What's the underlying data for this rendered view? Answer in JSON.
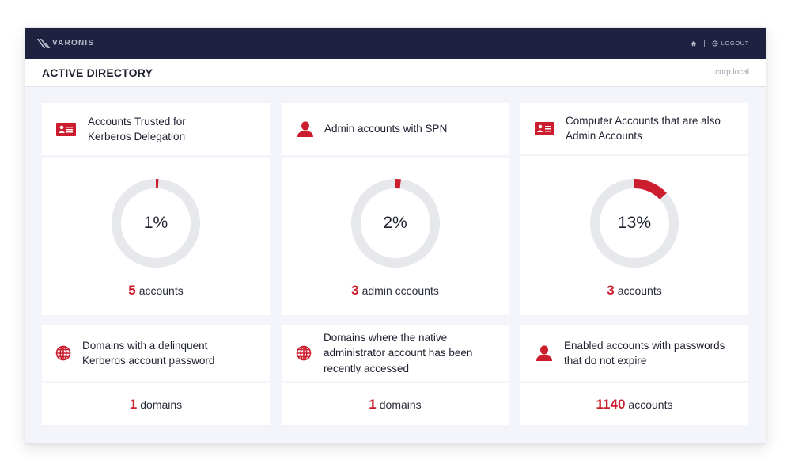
{
  "app": {
    "brand": "VARONIS",
    "logout_label": "LOGOUT",
    "page_title": "ACTIVE DIRECTORY",
    "domain": "corp.local"
  },
  "colors": {
    "accent": "#cc1d2e",
    "topbar": "#1e2240",
    "track": "#e6e8ec",
    "background": "#f4f5fa"
  },
  "cards_top": [
    {
      "icon": "id-card-icon",
      "title": "Accounts Trusted for Kerberos Delegation",
      "percent": 1,
      "percent_label": "1%",
      "count": "5",
      "unit": "accounts"
    },
    {
      "icon": "user-icon",
      "title": "Admin accounts with SPN",
      "percent": 2,
      "percent_label": "2%",
      "count": "3",
      "unit": "admin cccounts"
    },
    {
      "icon": "id-card-icon",
      "title": "Computer Accounts that are also Admin Accounts",
      "percent": 13,
      "percent_label": "13%",
      "count": "3",
      "unit": "accounts"
    }
  ],
  "cards_bottom": [
    {
      "icon": "globe-icon",
      "title": "Domains with a delinquent Kerberos account password",
      "count": "1",
      "unit": "domains"
    },
    {
      "icon": "globe-icon",
      "title": "Domains where the native administrator account has been recently accessed",
      "count": "1",
      "unit": "domains"
    },
    {
      "icon": "user-icon",
      "title": "Enabled accounts with passwords that do not expire",
      "count": "1140",
      "unit": "accounts"
    }
  ]
}
